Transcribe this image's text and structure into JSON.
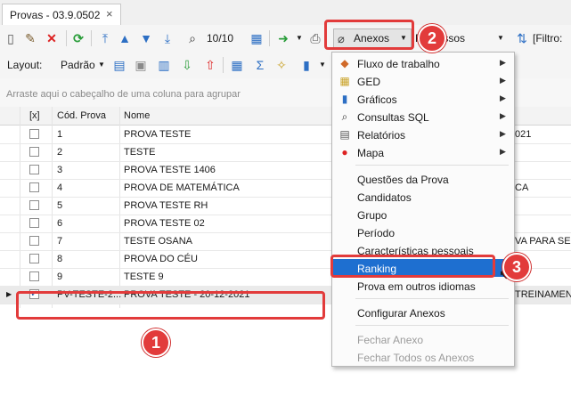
{
  "tab": {
    "title": "Provas - 03.9.0502",
    "close": "×"
  },
  "toolbar1": {
    "record_count": "10/10",
    "anexos_label": "Anexos",
    "processos_label": "Processos",
    "filtro_label": "[Filtro:"
  },
  "toolbar2": {
    "layout_label": "Layout:",
    "padrao_label": "Padrão"
  },
  "group_hint": "Arraste aqui o cabeçalho de uma coluna para agrupar",
  "grid": {
    "headers": {
      "check": "[x]",
      "code": "Cód. Prova",
      "name": "Nome"
    },
    "rows": [
      {
        "code": "1",
        "name": "PROVA TESTE",
        "extra": "021"
      },
      {
        "code": "2",
        "name": "TESTE",
        "extra": ""
      },
      {
        "code": "3",
        "name": "PROVA TESTE 1406",
        "extra": ""
      },
      {
        "code": "4",
        "name": "PROVA DE MATEMÁTICA",
        "extra": "CA"
      },
      {
        "code": "5",
        "name": "PROVA TESTE RH",
        "extra": ""
      },
      {
        "code": "6",
        "name": "PROVA TESTE 02",
        "extra": ""
      },
      {
        "code": "7",
        "name": "TESTE OSANA",
        "extra": "VA PARA SEMA"
      },
      {
        "code": "8",
        "name": "PROVA DO CÉU",
        "extra": ""
      },
      {
        "code": "9",
        "name": "TESTE 9",
        "extra": ""
      },
      {
        "code": "PV-TESTE-2...",
        "name": "PROVA TESTE - 20-12-2021",
        "extra": "TREINAMENT",
        "checked": "✓"
      }
    ]
  },
  "menu": {
    "items": [
      {
        "label": "Fluxo de trabalho"
      },
      {
        "label": "GED"
      },
      {
        "label": "Gráficos"
      },
      {
        "label": "Consultas SQL"
      },
      {
        "label": "Relatórios"
      },
      {
        "label": "Mapa"
      },
      {
        "label": "Questões da Prova"
      },
      {
        "label": "Candidatos"
      },
      {
        "label": "Grupo"
      },
      {
        "label": "Período"
      },
      {
        "label": "Características pessoais"
      },
      {
        "label": "Ranking"
      },
      {
        "label": "Prova em outros idiomas"
      },
      {
        "label": "Configurar Anexos"
      },
      {
        "label": "Fechar Anexo"
      },
      {
        "label": "Fechar Todos os Anexos"
      }
    ]
  },
  "badges": [
    "1",
    "2",
    "3"
  ],
  "colors": {
    "highlight": "#e23b3b",
    "menu_active": "#1e6fd0"
  }
}
